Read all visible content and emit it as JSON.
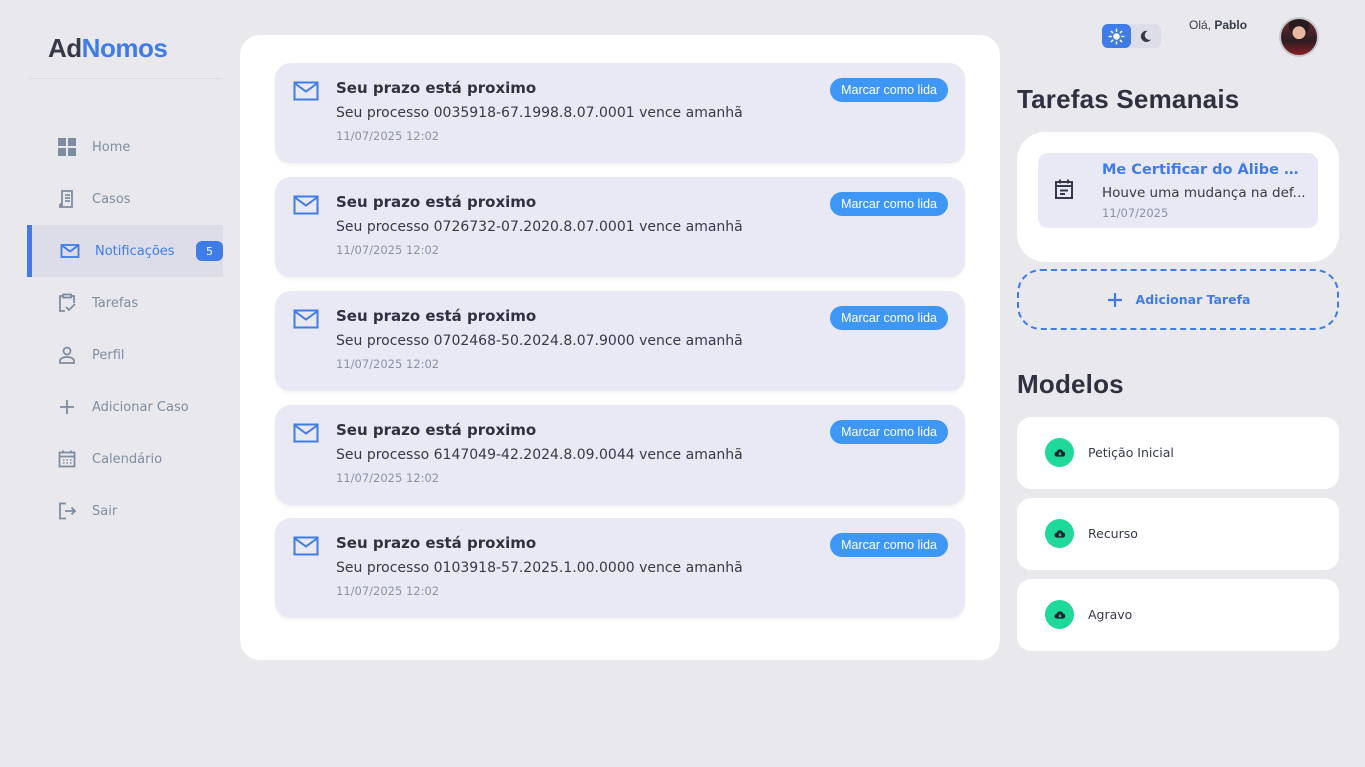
{
  "app": {
    "logo_part1": "Ad",
    "logo_part2": "Nomos"
  },
  "sidebar": {
    "items": [
      {
        "label": "Home",
        "icon": "grid-icon"
      },
      {
        "label": "Casos",
        "icon": "receipt-icon"
      },
      {
        "label": "Notificações",
        "icon": "mail-icon",
        "active": true,
        "badge": "5"
      },
      {
        "label": "Tarefas",
        "icon": "clipboard-check-icon"
      },
      {
        "label": "Perfil",
        "icon": "person-icon"
      },
      {
        "label": "Adicionar Caso",
        "icon": "plus-icon"
      },
      {
        "label": "Calendário",
        "icon": "calendar-icon"
      },
      {
        "label": "Sair",
        "icon": "logout-icon"
      }
    ]
  },
  "header": {
    "greeting": "Olá,",
    "user_name": "Pablo",
    "theme": {
      "light_icon": "sun-icon",
      "dark_icon": "moon-icon",
      "active": "light"
    }
  },
  "notifications": [
    {
      "title": "Seu prazo está proximo",
      "description": "Seu processo 0035918-67.1998.8.07.0001 vence amanhã",
      "date": "11/07/2025 12:02",
      "action": "Marcar como lida"
    },
    {
      "title": "Seu prazo está proximo",
      "description": "Seu processo 0726732-07.2020.8.07.0001 vence amanhã",
      "date": "11/07/2025 12:02",
      "action": "Marcar como lida"
    },
    {
      "title": "Seu prazo está proximo",
      "description": "Seu processo 0702468-50.2024.8.07.9000 vence amanhã",
      "date": "11/07/2025 12:02",
      "action": "Marcar como lida"
    },
    {
      "title": "Seu prazo está proximo",
      "description": "Seu processo 6147049-42.2024.8.09.0044 vence amanhã",
      "date": "11/07/2025 12:02",
      "action": "Marcar como lida"
    },
    {
      "title": "Seu prazo está proximo",
      "description": "Seu processo 0103918-57.2025.1.00.0000 vence amanhã",
      "date": "11/07/2025 12:02",
      "action": "Marcar como lida"
    }
  ],
  "weekly_tasks": {
    "title": "Tarefas Semanais",
    "items": [
      {
        "title": "Me Certificar do Álibe do C...",
        "description": "Houve uma mudança na def...",
        "date": "11/07/2025"
      }
    ],
    "add_label": "Adicionar Tarefa"
  },
  "models": {
    "title": "Modelos",
    "items": [
      {
        "label": "Petição Inicial",
        "icon": "cloud-download-icon"
      },
      {
        "label": "Recurso",
        "icon": "cloud-download-icon"
      },
      {
        "label": "Agravo",
        "icon": "cloud-download-icon"
      }
    ]
  },
  "colors": {
    "accent": "#3f7ce8",
    "button": "#3f97f5",
    "model_icon": "#1fd99b",
    "background": "#e9e9ed"
  }
}
